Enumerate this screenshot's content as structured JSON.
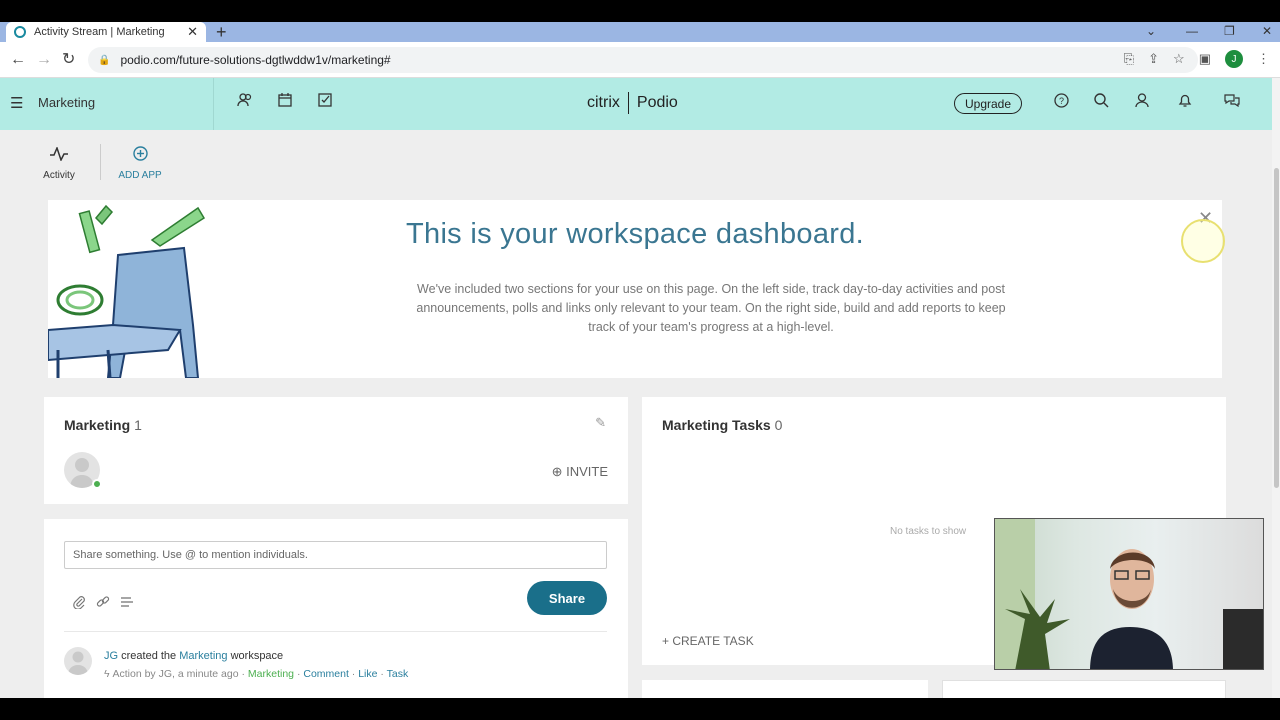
{
  "browser": {
    "tab_title": "Activity Stream | Marketing",
    "tab_close": "✕",
    "new_tab": "+",
    "url": "podio.com/future-solutions-dgtlwddw1v/marketing#",
    "profile_initial": "J"
  },
  "header": {
    "workspace_name": "Marketing",
    "brand_left": "citrix",
    "brand_right": "Podio",
    "upgrade_label": "Upgrade"
  },
  "appbar": {
    "activity_label": "Activity",
    "add_app_label": "ADD APP"
  },
  "banner": {
    "title": "This is your workspace dashboard.",
    "text": "We've included two sections for your use on this page. On the left side, track day-to-day activities and post announcements, polls and links only relevant to your team. On the right side, build and add reports to keep track of your team's progress at a high-level."
  },
  "members_card": {
    "title": "Marketing",
    "count": "1",
    "invite_label": "INVITE"
  },
  "tasks_card": {
    "title": "Marketing Tasks",
    "count": "0",
    "empty_text": "No tasks to show",
    "create_label": "+ CREATE TASK"
  },
  "share_card": {
    "placeholder": "Share something. Use @ to mention individuals.",
    "share_label": "Share",
    "activity": {
      "actor": "JG",
      "verb": "created the",
      "object": "Marketing",
      "suffix": "workspace",
      "meta_action": "Action",
      "meta_by": "by JG, a minute ago",
      "meta_sep": "·",
      "meta_workspace": "Marketing",
      "meta_comment": "Comment",
      "meta_like": "Like",
      "meta_task": "Task"
    }
  },
  "colors": {
    "header_bg": "#b2ebe4",
    "accent": "#1a6f8a",
    "title_blue": "#3a7691",
    "online_green": "#4caf50"
  }
}
